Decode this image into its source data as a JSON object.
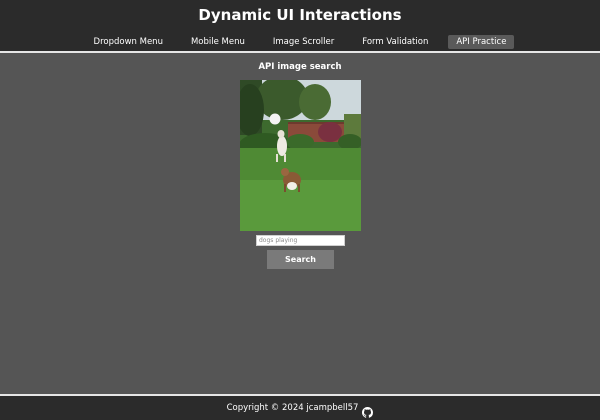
{
  "header": {
    "title": "Dynamic UI Interactions",
    "nav": [
      {
        "label": "Dropdown Menu",
        "active": false
      },
      {
        "label": "Mobile Menu",
        "active": false
      },
      {
        "label": "Image Scroller",
        "active": false
      },
      {
        "label": "Form Validation",
        "active": false
      },
      {
        "label": "API Practice",
        "active": true
      }
    ]
  },
  "main": {
    "section_title": "API image search",
    "image_subject": "two dogs playing with a ball on a lawn",
    "search": {
      "placeholder": "dogs playing",
      "value": "",
      "button_label": "Search"
    }
  },
  "footer": {
    "copyright": "Copyright © 2024 jcampbell57",
    "icon": "github-icon"
  },
  "colors": {
    "page_bg": "#555555",
    "header_bg": "#2b2b2b",
    "active_tab_bg": "#5a5a5a",
    "button_bg": "#7a7a7a",
    "divider": "#e6e6e6"
  }
}
